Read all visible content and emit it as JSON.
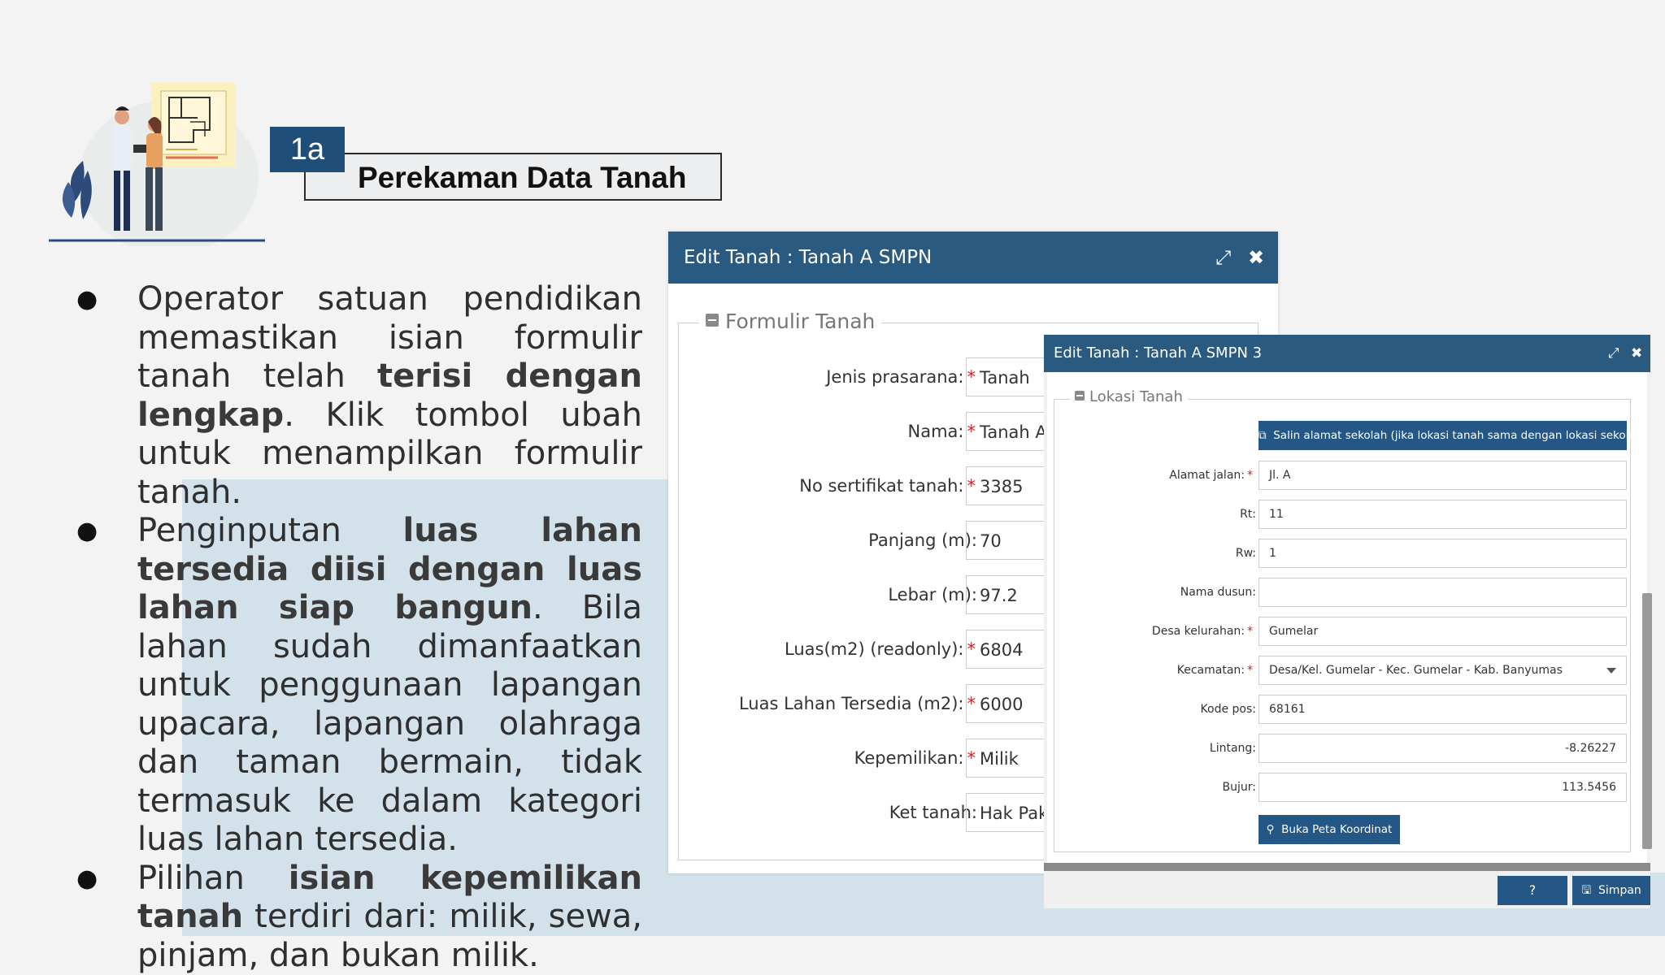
{
  "section": {
    "number": "1a",
    "title": "Perekaman Data Tanah"
  },
  "bullets": [
    {
      "parts": [
        {
          "text": "Operator satuan pendidikan memastikan isian formulir tanah telah ",
          "bold": false
        },
        {
          "text": "terisi dengan lengkap",
          "bold": true
        },
        {
          "text": ". Klik tombol ubah untuk menampilkan formulir tanah.",
          "bold": false
        }
      ]
    },
    {
      "parts": [
        {
          "text": "Penginputan ",
          "bold": false
        },
        {
          "text": "luas lahan tersedia diisi dengan luas lahan siap bangun",
          "bold": true
        },
        {
          "text": ". Bila lahan sudah dimanfaatkan untuk penggunaan lapangan upacara, lapangan olahraga dan taman bermain, tidak termasuk ke dalam kategori luas lahan tersedia.",
          "bold": false
        }
      ]
    },
    {
      "parts": [
        {
          "text": "Pilihan ",
          "bold": false
        },
        {
          "text": "isian kepemilikan tanah",
          "bold": true
        },
        {
          "text": " terdiri dari: milik, sewa, pinjam, dan bukan milik.",
          "bold": false
        }
      ]
    }
  ],
  "window1": {
    "title": "Edit Tanah : Tanah A SMPN",
    "legend": "Formulir Tanah",
    "fields": [
      {
        "label": "Jenis prasarana:",
        "required": true,
        "value": "Tanah"
      },
      {
        "label": "Nama:",
        "required": true,
        "value": "Tanah A"
      },
      {
        "label": "No sertifikat tanah:",
        "required": true,
        "value": "3385"
      },
      {
        "label": "Panjang (m):",
        "required": false,
        "value": "70"
      },
      {
        "label": "Lebar (m):",
        "required": false,
        "value": "97.2"
      },
      {
        "label": "Luas(m2) (readonly):",
        "required": true,
        "value": "6804"
      },
      {
        "label": "Luas Lahan Tersedia (m2):",
        "required": true,
        "value": "6000"
      },
      {
        "label": "Kepemilikan:",
        "required": true,
        "value": "Milik"
      },
      {
        "label": "Ket tanah:",
        "required": false,
        "value": "Hak Paka"
      }
    ]
  },
  "window2": {
    "title": "Edit Tanah : Tanah A SMPN 3",
    "legend": "Lokasi Tanah",
    "copy_button": "Salin alamat sekolah (jika lokasi tanah sama dengan lokasi sekolah)",
    "fields": [
      {
        "label": "Alamat jalan:",
        "required": true,
        "value": "Jl. A",
        "align": "left"
      },
      {
        "label": "Rt:",
        "required": false,
        "value": "11",
        "align": "left"
      },
      {
        "label": "Rw:",
        "required": false,
        "value": "1",
        "align": "left"
      },
      {
        "label": "Nama dusun:",
        "required": false,
        "value": "",
        "align": "left"
      },
      {
        "label": "Desa kelurahan:",
        "required": true,
        "value": "Gumelar",
        "align": "left"
      },
      {
        "label": "Kecamatan:",
        "required": true,
        "value": "Desa/Kel. Gumelar - Kec. Gumelar - Kab. Banyumas",
        "align": "left",
        "select": true
      },
      {
        "label": "Kode pos:",
        "required": false,
        "value": "68161",
        "align": "left"
      },
      {
        "label": "Lintang:",
        "required": false,
        "value": "-8.26227",
        "align": "right"
      },
      {
        "label": "Bujur:",
        "required": false,
        "value": "113.5456",
        "align": "right"
      }
    ],
    "map_button": "Buka Peta Koordinat",
    "help_icon": "?",
    "save_button": "Simpan"
  },
  "colors": {
    "header": "#2a5a80",
    "button": "#245785",
    "section_badge": "#1f4e79",
    "accent_bg": "#d2e1ea"
  }
}
